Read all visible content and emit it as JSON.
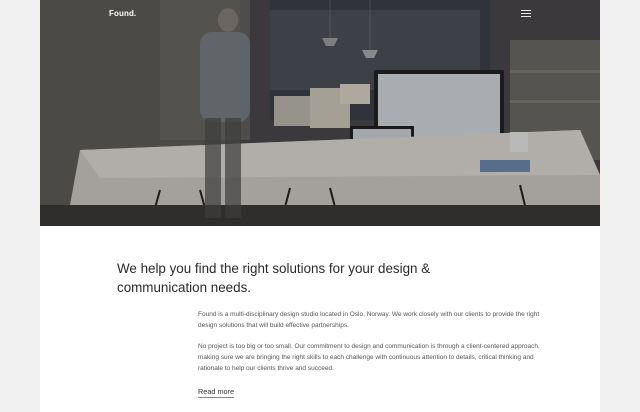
{
  "header": {
    "logo": "Found.",
    "menu_icon": "hamburger-menu-icon"
  },
  "hero": {
    "image": "office-scene-photo"
  },
  "intro": {
    "headline": "We help you find the right solutions for your design & communication needs.",
    "paragraphs": [
      "Found is a multi-disciplinary design studio located in Oslo, Norway. We work closely with our clients to provide the right design solutions that will build effective partnerships.",
      "No project is too big or too small. Our commitment to design and communication is through a client-centered approach, making sure we are bringing the right skills to each challenge with continuous attention to details, critical thinking and rationale to help our clients thrive and succeed."
    ],
    "read_more": "Read more"
  }
}
